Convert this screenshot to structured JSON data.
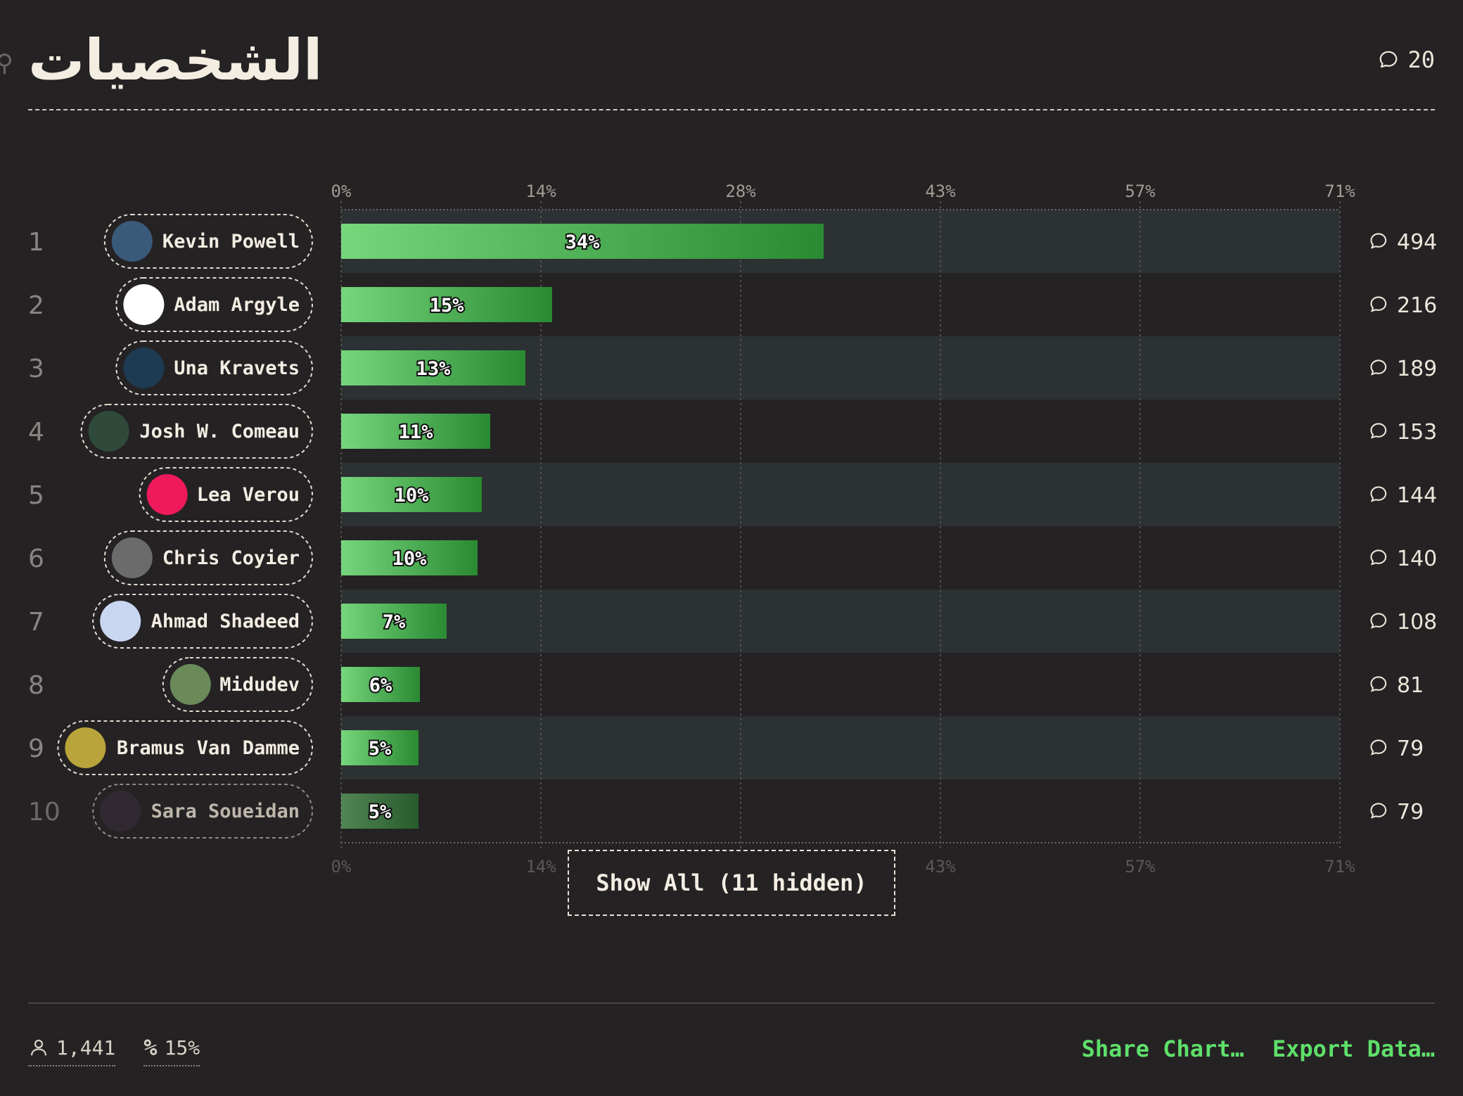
{
  "header": {
    "title": "الشخصيات",
    "comment_count": "20"
  },
  "chart_data": {
    "type": "bar",
    "orientation": "horizontal",
    "title": "الشخصيات",
    "xlim": [
      0,
      71
    ],
    "x_ticks": [
      "0%",
      "14%",
      "28%",
      "43%",
      "57%",
      "71%"
    ],
    "x_tick_values": [
      0,
      14.2,
      28.4,
      42.6,
      56.8,
      71
    ],
    "categories": [
      "Kevin Powell",
      "Adam Argyle",
      "Una Kravets",
      "Josh W. Comeau",
      "Lea Verou",
      "Chris Coyier",
      "Ahmad Shadeed",
      "Midudev",
      "Bramus Van Damme",
      "Sara Soueidan"
    ],
    "ranks": [
      "1",
      "2",
      "3",
      "4",
      "5",
      "6",
      "7",
      "8",
      "9",
      "10"
    ],
    "values": [
      34.3,
      15.0,
      13.1,
      10.6,
      10.0,
      9.7,
      7.5,
      5.6,
      5.5,
      5.5
    ],
    "value_labels": [
      "34%",
      "15%",
      "13%",
      "11%",
      "10%",
      "10%",
      "7%",
      "6%",
      "5%",
      "5%"
    ],
    "comment_counts": [
      "494",
      "216",
      "189",
      "153",
      "144",
      "140",
      "108",
      "81",
      "79",
      "79"
    ],
    "avatar_colors": [
      "#3a5a7a",
      "#ffffff",
      "#1d3b52",
      "#2f4a3a",
      "#ef1a5b",
      "#6b6b6b",
      "#c9d6f0",
      "#6a8a5a",
      "#b8a43a",
      "#3a2f3a"
    ],
    "grid": true,
    "colors": {
      "bar_light": "#76d67c",
      "bar_dark": "#2a8a32",
      "band": "#2c3133"
    }
  },
  "show_all_label": "Show All (11 hidden)",
  "footer": {
    "respondents": "1,441",
    "percent": "15%",
    "share_label": "Share Chart…",
    "export_label": "Export Data…"
  }
}
